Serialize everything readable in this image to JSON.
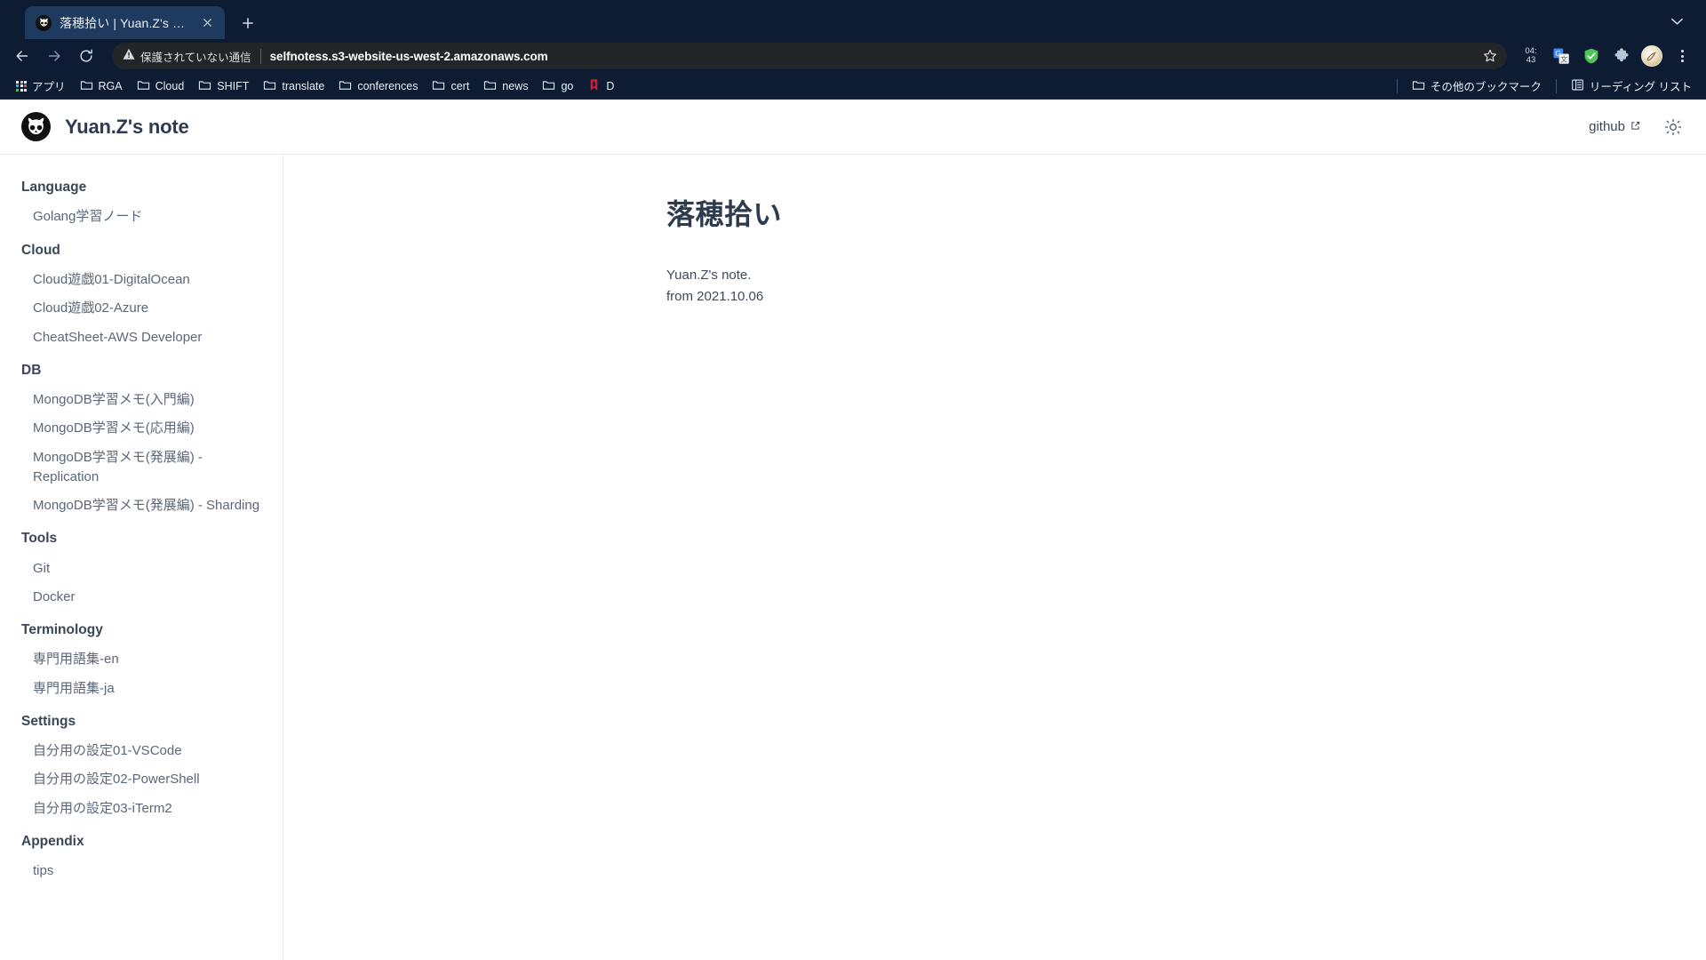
{
  "browser": {
    "tab": {
      "title": "落穂拾い | Yuan.Z's note",
      "favicon": "owl-icon",
      "close": "×"
    },
    "new_tab_label": "+",
    "window_chevron": "chevron-down-icon",
    "nav": {
      "back": "back-arrow-icon",
      "forward": "forward-arrow-icon",
      "reload": "reload-icon"
    },
    "omnibox": {
      "security_text": "保護されていない通信",
      "security_icon": "warning-triangle-icon",
      "url": "selfnotess.s3-website-us-west-2.amazonaws.com",
      "bookmark_star": "star-icon"
    },
    "toolbar_icons": [
      {
        "name": "clock-extension",
        "label_top": "04:",
        "label_bottom": "43"
      },
      {
        "name": "google-translate-icon",
        "label": ""
      },
      {
        "name": "adblock-shield-icon",
        "label": ""
      },
      {
        "name": "extensions-puzzle-icon",
        "label": ""
      },
      {
        "name": "profile-avatar",
        "label": ""
      },
      {
        "name": "chrome-menu-kebab-icon",
        "label": ""
      }
    ],
    "bookmarks": {
      "apps_label": "アプリ",
      "items": [
        {
          "label": "RGA",
          "icon": "folder-icon"
        },
        {
          "label": "Cloud",
          "icon": "folder-icon"
        },
        {
          "label": "SHIFT",
          "icon": "folder-icon"
        },
        {
          "label": "translate",
          "icon": "folder-icon"
        },
        {
          "label": "conferences",
          "icon": "folder-icon"
        },
        {
          "label": "cert",
          "icon": "folder-icon"
        },
        {
          "label": "news",
          "icon": "folder-icon"
        },
        {
          "label": "go",
          "icon": "folder-icon"
        },
        {
          "label": "D",
          "icon": "red-bookmark-icon"
        }
      ],
      "other_bookmarks": "その他のブックマーク",
      "reading_list": "リーディング リスト"
    }
  },
  "site": {
    "header": {
      "logo": "owl-logo",
      "title": "Yuan.Z's note",
      "github_label": "github",
      "github_external_icon": "external-link-icon",
      "theme_toggle_icon": "sun-icon"
    },
    "sidebar": {
      "groups": [
        {
          "heading": "Language",
          "items": [
            "Golang学習ノード"
          ]
        },
        {
          "heading": "Cloud",
          "items": [
            "Cloud遊戯01-DigitalOcean",
            "Cloud遊戯02-Azure",
            "CheatSheet-AWS Developer"
          ]
        },
        {
          "heading": "DB",
          "items": [
            "MongoDB学習メモ(入門編)",
            "MongoDB学習メモ(応用編)",
            "MongoDB学習メモ(発展編) - Replication",
            "MongoDB学習メモ(発展編) - Sharding"
          ]
        },
        {
          "heading": "Tools",
          "items": [
            "Git",
            "Docker"
          ]
        },
        {
          "heading": "Terminology",
          "items": [
            "専門用語集-en",
            "専門用語集-ja"
          ]
        },
        {
          "heading": "Settings",
          "items": [
            "自分用の設定01-VSCode",
            "自分用の設定02-PowerShell",
            "自分用の設定03-iTerm2"
          ]
        },
        {
          "heading": "Appendix",
          "items": [
            "tips"
          ]
        }
      ]
    },
    "content": {
      "title": "落穂拾い",
      "paragraphs": [
        "Yuan.Z's note.",
        "from 2021.10.06"
      ]
    }
  }
}
